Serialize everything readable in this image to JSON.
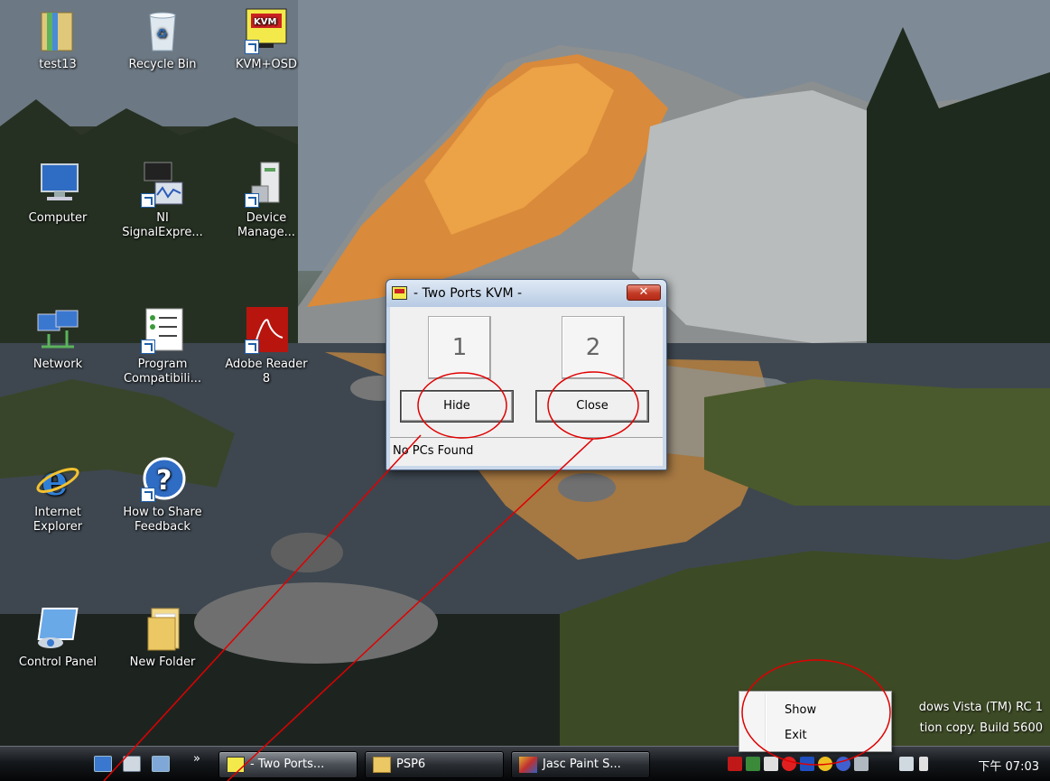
{
  "desktop": {
    "icons": [
      {
        "label": "test13",
        "icon": "folder-zip-icon"
      },
      {
        "label": "Recycle Bin",
        "icon": "recycle-bin-icon"
      },
      {
        "label": "KVM+OSD",
        "icon": "kvm-icon"
      },
      {
        "label": "Computer",
        "icon": "computer-icon"
      },
      {
        "label": "NI SignalExpre...",
        "icon": "signal-express-icon"
      },
      {
        "label": "Device Manage...",
        "icon": "device-manager-icon"
      },
      {
        "label": "Network",
        "icon": "network-icon"
      },
      {
        "label": "Program Compatibili...",
        "icon": "program-compatibility-icon"
      },
      {
        "label": "Adobe Reader 8",
        "icon": "adobe-reader-icon"
      },
      {
        "label": "Internet Explorer",
        "icon": "internet-explorer-icon"
      },
      {
        "label": "How to Share Feedback",
        "icon": "help-icon"
      },
      {
        "label": "Control Panel",
        "icon": "control-panel-icon"
      },
      {
        "label": "New Folder",
        "icon": "folder-icon"
      }
    ],
    "watermark": {
      "line1": "dows Vista (TM) RC 1",
      "line2": "tion copy. Build 5600"
    }
  },
  "dialog": {
    "title": "- Two Ports KVM -",
    "close_glyph": "✕",
    "port1": "1",
    "port2": "2",
    "hide_label": "Hide",
    "close_label": "Close",
    "status": "No PCs Found"
  },
  "context_menu": {
    "items": [
      "Show",
      "Exit"
    ]
  },
  "taskbar": {
    "more_glyph": "»",
    "buttons": [
      {
        "label": "- Two Ports...",
        "icon": "kvm-app-icon"
      },
      {
        "label": "PSP6",
        "icon": "folder-icon"
      },
      {
        "label": "Jasc Paint S...",
        "icon": "paint-shop-icon"
      }
    ],
    "clock": "下午 07:03"
  },
  "colors": {
    "annotation": "#e00000",
    "taskbar": "#15181c",
    "dialog_close": "#c23b25"
  }
}
